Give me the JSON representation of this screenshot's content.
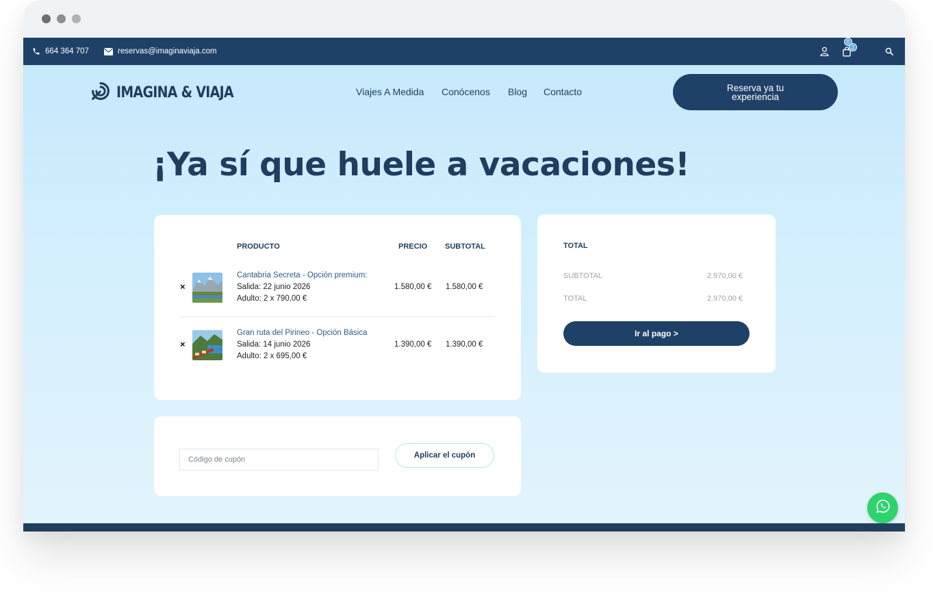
{
  "topbar": {
    "phone": "664 364 707",
    "email": "reservas@imaginaviaja.com",
    "cart_count": "2",
    "wishlist_count": "0"
  },
  "header": {
    "logo_text": "IMAGINA & VIAJA",
    "nav": [
      "Viajes A Medida",
      "Conócenos",
      "Blog",
      "Contacto"
    ],
    "cta_label": "Reserva ya tu experiencia"
  },
  "hero": {
    "title": "¡Ya sí que huele a vacaciones!"
  },
  "cart": {
    "headers": {
      "product": "PRODUCTO",
      "price": "PRECIO",
      "subtotal": "SUBTOTAL"
    },
    "remove_symbol": "×",
    "items": [
      {
        "name": "Cantabria Secreta - Opción premium:",
        "departure": "Salida: 22 junio 2026",
        "adult": "Adulto: 2 x 790,00 €",
        "price": "1.580,00 €",
        "subtotal": "1.580,00 €",
        "thumb_icon": "mountain-lake-photo"
      },
      {
        "name": "Gran ruta del Pirineo - Opción Básica",
        "departure": "Salida: 14 junio 2026",
        "adult": "Adulto: 2 x 695,00 €",
        "price": "1.390,00 €",
        "subtotal": "1.390,00 €",
        "thumb_icon": "train-landscape-photo"
      }
    ]
  },
  "totals": {
    "title": "TOTAL",
    "subtotal_label": "SUBTOTAL",
    "subtotal_value": "2.970,00 €",
    "total_label": "TOTAL",
    "total_value": "2.970,00 €",
    "checkout_label": "Ir al pago >"
  },
  "coupon": {
    "placeholder": "Código de cupón",
    "apply_label": "Aplicar el cupón"
  },
  "colors": {
    "navy": "#1f4168",
    "accent_light_blue": "#c6e9fc",
    "whatsapp_green": "#2cd46b"
  },
  "icons": [
    "phone-icon",
    "mail-icon",
    "user-icon",
    "cart-icon",
    "search-icon",
    "whatsapp-icon",
    "logo-icon"
  ]
}
